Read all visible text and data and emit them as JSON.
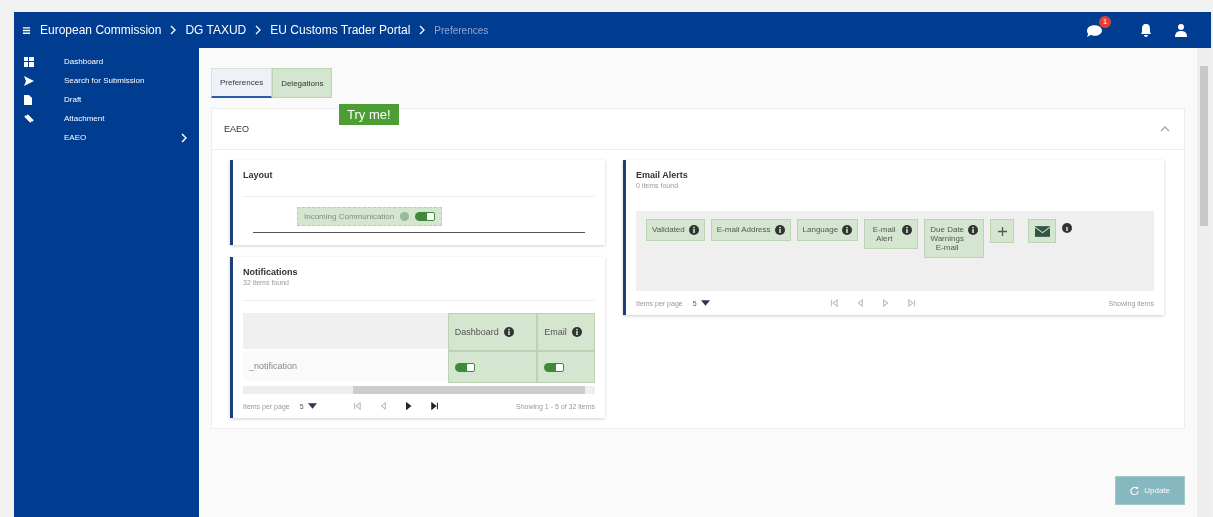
{
  "header": {
    "breadcrumbs": [
      {
        "label": "European Commission",
        "current": false
      },
      {
        "label": "DG TAXUD",
        "current": false
      },
      {
        "label": "EU Customs Trader Portal",
        "current": false
      },
      {
        "label": "Preferences",
        "current": true
      }
    ],
    "message_badge": "1"
  },
  "sidebar": {
    "items": [
      {
        "label": "Dashboard",
        "kind": "dashboard",
        "expandable": false
      },
      {
        "label": "Search for Submission",
        "kind": "send",
        "expandable": false
      },
      {
        "label": "Draft",
        "kind": "file",
        "expandable": false
      },
      {
        "label": "Attachment",
        "kind": "attachment",
        "expandable": false
      },
      {
        "label": "EAEO",
        "kind": "none",
        "expandable": true
      }
    ]
  },
  "tabs": [
    {
      "label": "Preferences",
      "selected": true,
      "highlighted": false
    },
    {
      "label": "Delegations",
      "selected": false,
      "highlighted": true
    }
  ],
  "tour_tip": "Try me!",
  "section": {
    "title": "EAEO",
    "expanded": true
  },
  "layout_card": {
    "title": "Layout",
    "toggles": [
      {
        "label": "Incoming Communication",
        "on": true
      }
    ]
  },
  "notifications": {
    "title": "Notifications",
    "count": "32 items found",
    "columns": [
      "Dashboard",
      "Email"
    ],
    "rows": [
      {
        "name": "_notification",
        "values": [
          {
            "on": true
          },
          {
            "on": true
          }
        ]
      }
    ],
    "pager": {
      "per_page_label": "Items per page",
      "per_page": "5",
      "nav": [
        {
          "kind": "first",
          "disabled": true
        },
        {
          "kind": "prev",
          "disabled": true
        },
        {
          "kind": "next",
          "disabled": false
        },
        {
          "kind": "last",
          "disabled": false
        }
      ],
      "info": "Showing 1 - 5 of 32 items"
    }
  },
  "email_alerts": {
    "title": "Email Alerts",
    "count": "0 items found",
    "columns": [
      "Validated",
      "E-mail Address",
      "Language",
      "E-mail Alert",
      "Due Date Warnings E-mail"
    ],
    "pager": {
      "per_page_label": "Items per page",
      "per_page": "5",
      "nav": [
        {
          "kind": "first",
          "disabled": true
        },
        {
          "kind": "prev",
          "disabled": true
        },
        {
          "kind": "next",
          "disabled": true
        },
        {
          "kind": "last",
          "disabled": true
        }
      ],
      "info": "Showing items"
    }
  },
  "update_button": {
    "label": "Update",
    "disabled": true
  }
}
